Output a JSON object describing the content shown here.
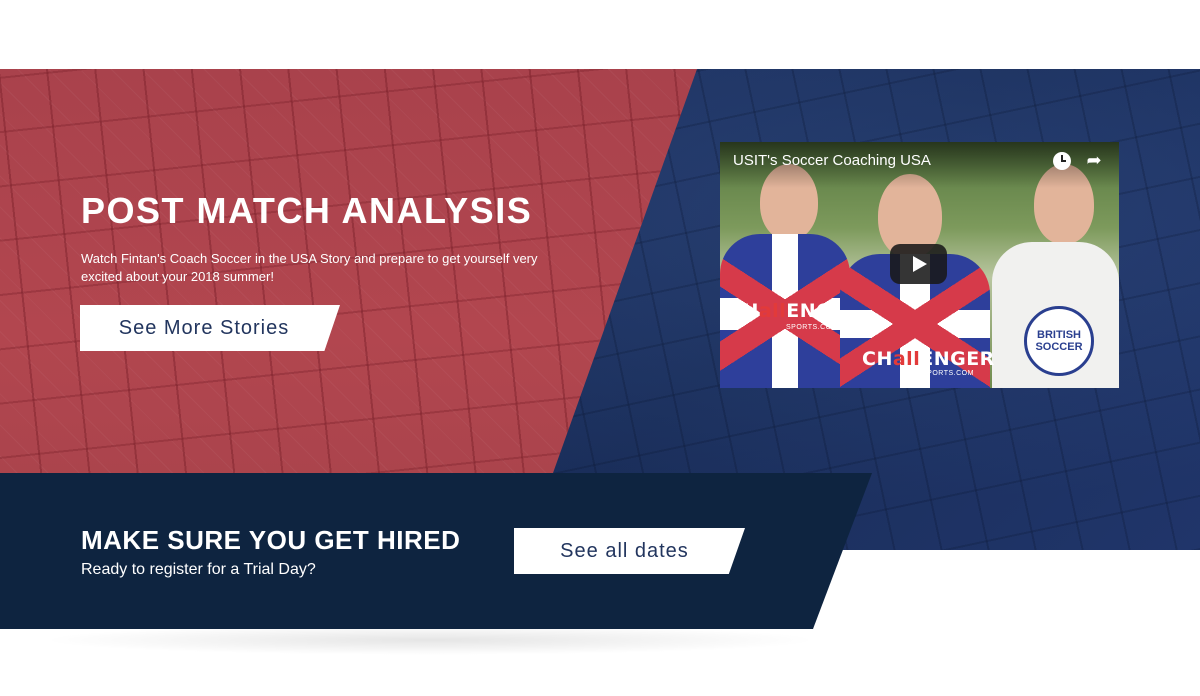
{
  "hero": {
    "title": "POST MATCH ANALYSIS",
    "description": "Watch Fintan's Coach Soccer in the USA Story and prepare to get yourself very excited about your 2018 summer!",
    "button_label": "See More Stories"
  },
  "video": {
    "title": "USIT's Soccer Coaching USA",
    "icons": [
      "clock-icon",
      "share-icon",
      "play-icon"
    ],
    "sponsor_left": {
      "pre": "CH",
      "hl": "all",
      "post": "ENGER",
      "sub": "SPORTS.COM"
    },
    "sponsor_center": {
      "pre": "CH",
      "hl": "all",
      "post": "ENGER",
      "sub": "SPORTS.COM"
    },
    "badge_text": "BRITISH SOCCER"
  },
  "hire": {
    "title": "MAKE SURE YOU GET HIRED",
    "subtitle": "Ready to register for a Trial Day?",
    "button_label": "See all dates"
  },
  "colors": {
    "red_panel": "#b2464f",
    "blue_panel": "#1f3565",
    "dark_panel": "#0e2440",
    "button_text": "#22355e"
  }
}
